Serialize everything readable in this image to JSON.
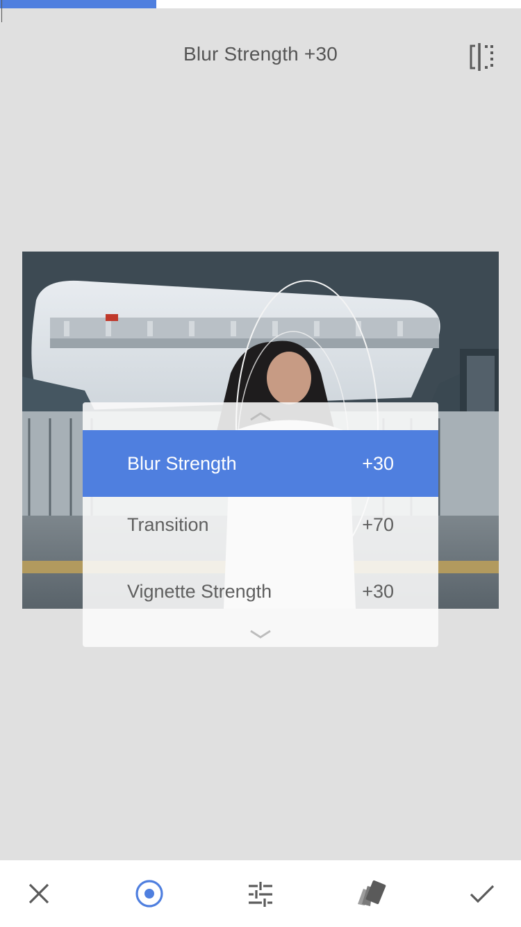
{
  "header": {
    "title": "Blur Strength +30",
    "progress_fraction": 0.3
  },
  "params": {
    "items": [
      {
        "label": "Blur Strength",
        "value": "+30"
      },
      {
        "label": "Transition",
        "value": "+70"
      },
      {
        "label": "Vignette Strength",
        "value": "+30"
      }
    ],
    "selected_index": 0
  },
  "toolbar": {
    "items": [
      "close",
      "focus-point",
      "adjust-sliders",
      "styles",
      "apply"
    ]
  },
  "icons": {
    "compare": "compare-icon",
    "scroll_up": "chevron-up-icon",
    "scroll_down": "chevron-down-icon",
    "close": "close-icon",
    "focus": "target-icon",
    "tune": "sliders-icon",
    "styles": "cards-icon",
    "apply": "check-icon"
  },
  "colors": {
    "accent": "#4f7fdf",
    "background": "#e0e0e0",
    "text": "#555555",
    "icon_gray": "#5a5a5a"
  }
}
